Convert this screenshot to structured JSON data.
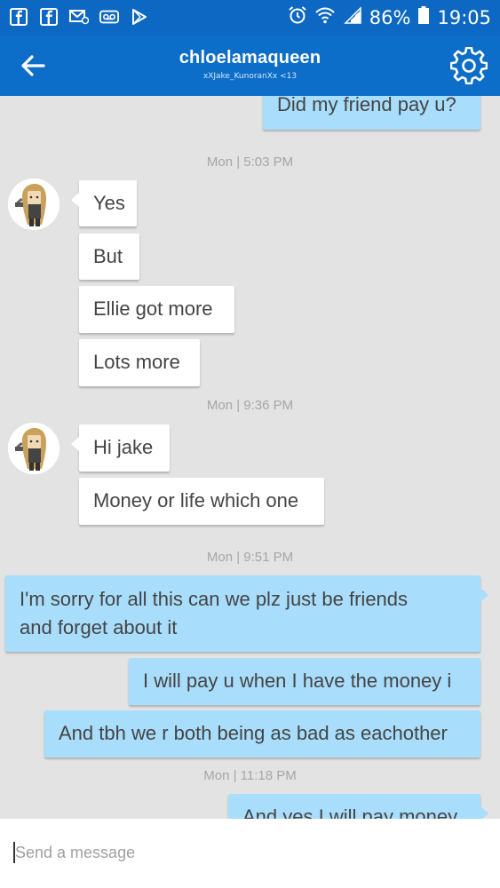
{
  "status_bar": {
    "icons_left": [
      "facebook-icon",
      "facebook-icon",
      "email-icon",
      "voicemail-icon",
      "play-store-icon"
    ],
    "icons_right": [
      "alarm-icon",
      "wifi-icon",
      "signal-icon"
    ],
    "battery": "86%",
    "time": "19:05"
  },
  "header": {
    "title": "chloelamaqueen",
    "subtitle": "xXJake_KunoranXx <13",
    "accent": "#0d6ec9"
  },
  "messages": {
    "m0": "Did my friend pay u?",
    "t1": "Mon | 5:03 PM",
    "m1": "Yes",
    "m2": "But",
    "m3": "Ellie got more",
    "m4": "Lots more",
    "t2": "Mon | 9:36 PM",
    "m5": "Hi jake",
    "m6": "Money or life which one",
    "t3": "Mon | 9:51 PM",
    "m7a": "I'm sorry for all this can we plz just be friends",
    "m7b": "and forget about it",
    "m8": "I will pay u when I have the money i",
    "m9": "And tbh we r both being as bad as eachother",
    "t4": "Mon | 11:18 PM",
    "m10": "And yes I will pay money"
  },
  "composer": {
    "placeholder": "Send a message"
  }
}
